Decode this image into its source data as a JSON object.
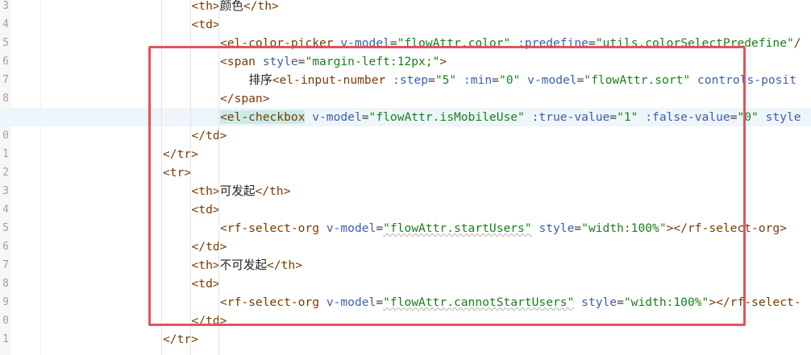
{
  "editor": {
    "line_numbers": [
      "3",
      "4",
      "5",
      "6",
      "7",
      "8",
      "9",
      "0",
      "1",
      "2",
      "3",
      "4",
      "5",
      "6",
      "7",
      "8",
      "9",
      "0",
      "1"
    ],
    "current_line_index": 6,
    "lines": [
      {
        "indent": 1,
        "tokens": [
          {
            "t": "tag",
            "v": "<th>"
          },
          {
            "t": "text",
            "v": "颜色"
          },
          {
            "t": "tag",
            "v": "</th>"
          }
        ]
      },
      {
        "indent": 1,
        "tokens": [
          {
            "t": "tag",
            "v": "<td>"
          }
        ]
      },
      {
        "indent": 2,
        "tokens": [
          {
            "t": "tag",
            "v": "<el-color-picker"
          },
          {
            "t": "text",
            "v": " "
          },
          {
            "t": "attr",
            "v": "v-model"
          },
          {
            "t": "eq",
            "v": "="
          },
          {
            "t": "str",
            "v": "\"flowAttr.color\""
          },
          {
            "t": "text",
            "v": " "
          },
          {
            "t": "attr",
            "v": ":predefine"
          },
          {
            "t": "eq",
            "v": "="
          },
          {
            "t": "str",
            "v": "\"utils.colorSelectPredefine\""
          },
          {
            "t": "tag",
            "v": "/"
          }
        ]
      },
      {
        "indent": 2,
        "tokens": [
          {
            "t": "tag",
            "v": "<span"
          },
          {
            "t": "text",
            "v": " "
          },
          {
            "t": "attr",
            "v": "style"
          },
          {
            "t": "eq",
            "v": "="
          },
          {
            "t": "str",
            "v": "\"margin-left:12px;\""
          },
          {
            "t": "tag",
            "v": ">"
          }
        ]
      },
      {
        "indent": 3,
        "tokens": [
          {
            "t": "text",
            "v": "排序"
          },
          {
            "t": "tag",
            "v": "<el-input-number"
          },
          {
            "t": "text",
            "v": " "
          },
          {
            "t": "attr",
            "v": ":step"
          },
          {
            "t": "eq",
            "v": "="
          },
          {
            "t": "str",
            "v": "\"5\""
          },
          {
            "t": "text",
            "v": " "
          },
          {
            "t": "attr",
            "v": ":min"
          },
          {
            "t": "eq",
            "v": "="
          },
          {
            "t": "str",
            "v": "\"0\""
          },
          {
            "t": "text",
            "v": " "
          },
          {
            "t": "attr",
            "v": "v-model"
          },
          {
            "t": "eq",
            "v": "="
          },
          {
            "t": "str",
            "v": "\"flowAttr.sort\""
          },
          {
            "t": "text",
            "v": " "
          },
          {
            "t": "attr",
            "v": "controls-posit"
          }
        ]
      },
      {
        "indent": 2,
        "tokens": [
          {
            "t": "tag",
            "v": "</span>"
          }
        ]
      },
      {
        "indent": 2,
        "tokens": [
          {
            "t": "tag",
            "v": "<el-checkbox",
            "m": true
          },
          {
            "t": "text",
            "v": " "
          },
          {
            "t": "attr",
            "v": "v-model"
          },
          {
            "t": "eq",
            "v": "="
          },
          {
            "t": "str",
            "v": "\"flowAttr.isMobileUse\""
          },
          {
            "t": "text",
            "v": " "
          },
          {
            "t": "attr",
            "v": ":true-value"
          },
          {
            "t": "eq",
            "v": "="
          },
          {
            "t": "str",
            "v": "\"1\""
          },
          {
            "t": "text",
            "v": " "
          },
          {
            "t": "attr",
            "v": ":false-value"
          },
          {
            "t": "eq",
            "v": "="
          },
          {
            "t": "str",
            "v": "\"0\""
          },
          {
            "t": "text",
            "v": " "
          },
          {
            "t": "attr",
            "v": "style"
          }
        ]
      },
      {
        "indent": 1,
        "tokens": [
          {
            "t": "tag",
            "v": "</td>"
          }
        ]
      },
      {
        "indent": 0,
        "tokens": [
          {
            "t": "tag",
            "v": "</tr>"
          }
        ]
      },
      {
        "indent": 0,
        "tokens": [
          {
            "t": "tag",
            "v": "<tr>"
          }
        ]
      },
      {
        "indent": 1,
        "tokens": [
          {
            "t": "tag",
            "v": "<th>"
          },
          {
            "t": "text",
            "v": "可发起"
          },
          {
            "t": "tag",
            "v": "</th>"
          }
        ]
      },
      {
        "indent": 1,
        "tokens": [
          {
            "t": "tag",
            "v": "<td>"
          }
        ]
      },
      {
        "indent": 2,
        "tokens": [
          {
            "t": "tag",
            "v": "<rf-select-org"
          },
          {
            "t": "text",
            "v": " "
          },
          {
            "t": "attr",
            "v": "v-model"
          },
          {
            "t": "eq",
            "v": "="
          },
          {
            "t": "str",
            "v": "\"flowAttr.startUsers\"",
            "s": true
          },
          {
            "t": "text",
            "v": " "
          },
          {
            "t": "attr",
            "v": "style"
          },
          {
            "t": "eq",
            "v": "="
          },
          {
            "t": "str",
            "v": "\"width:100%\""
          },
          {
            "t": "tag",
            "v": "></rf-select-org>"
          }
        ]
      },
      {
        "indent": 1,
        "tokens": [
          {
            "t": "tag",
            "v": "</td>"
          }
        ]
      },
      {
        "indent": 1,
        "tokens": [
          {
            "t": "tag",
            "v": "<th>"
          },
          {
            "t": "text",
            "v": "不可发起"
          },
          {
            "t": "tag",
            "v": "</th>"
          }
        ]
      },
      {
        "indent": 1,
        "tokens": [
          {
            "t": "tag",
            "v": "<td>"
          }
        ]
      },
      {
        "indent": 2,
        "tokens": [
          {
            "t": "tag",
            "v": "<rf-select-org"
          },
          {
            "t": "text",
            "v": " "
          },
          {
            "t": "attr",
            "v": "v-model"
          },
          {
            "t": "eq",
            "v": "="
          },
          {
            "t": "str",
            "v": "\"flowAttr.cannotStartUsers\"",
            "s": true
          },
          {
            "t": "text",
            "v": " "
          },
          {
            "t": "attr",
            "v": "style"
          },
          {
            "t": "eq",
            "v": "="
          },
          {
            "t": "str",
            "v": "\"width:100%\""
          },
          {
            "t": "tag",
            "v": "></rf-select-"
          }
        ]
      },
      {
        "indent": 1,
        "tokens": [
          {
            "t": "tag",
            "v": "</td>"
          }
        ]
      },
      {
        "indent": 0,
        "tokens": [
          {
            "t": "tag",
            "v": "</tr>"
          }
        ]
      }
    ]
  },
  "colors": {
    "tag": "#7a3a00",
    "attribute": "#3b5eab",
    "string": "#1a7f1a",
    "selection_box": "#e0535d",
    "current_line": "#eef5fb",
    "bracket_match": "#c9ece8"
  }
}
